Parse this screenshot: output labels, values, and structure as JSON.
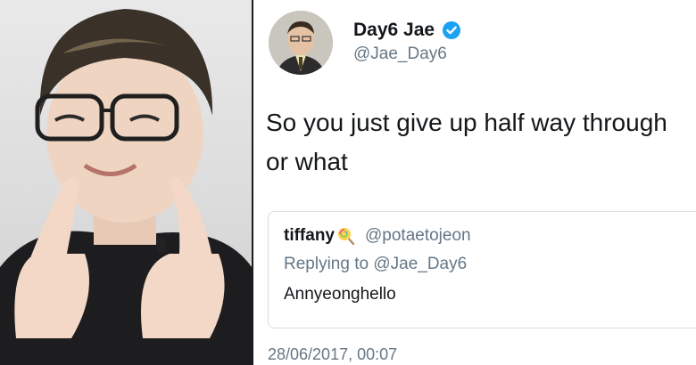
{
  "tweet": {
    "display_name": "Day6 Jae",
    "handle": "@Jae_Day6",
    "text_line1": "So you just give up half way through",
    "text_line2": "or what",
    "timestamp": "28/06/2017, 00:07",
    "verified_icon": "verified-badge-icon"
  },
  "quoted": {
    "name": "tiffany",
    "emoji_icon": "lollipop-icon",
    "handle": "@potaetojeon",
    "reply_prefix": "Replying to ",
    "reply_to": "@Jae_Day6",
    "body": "Annyeonghello"
  },
  "colors": {
    "text": "#14171a",
    "secondary": "#657786",
    "verified": "#1da1f2",
    "border": "#d8dde2"
  }
}
